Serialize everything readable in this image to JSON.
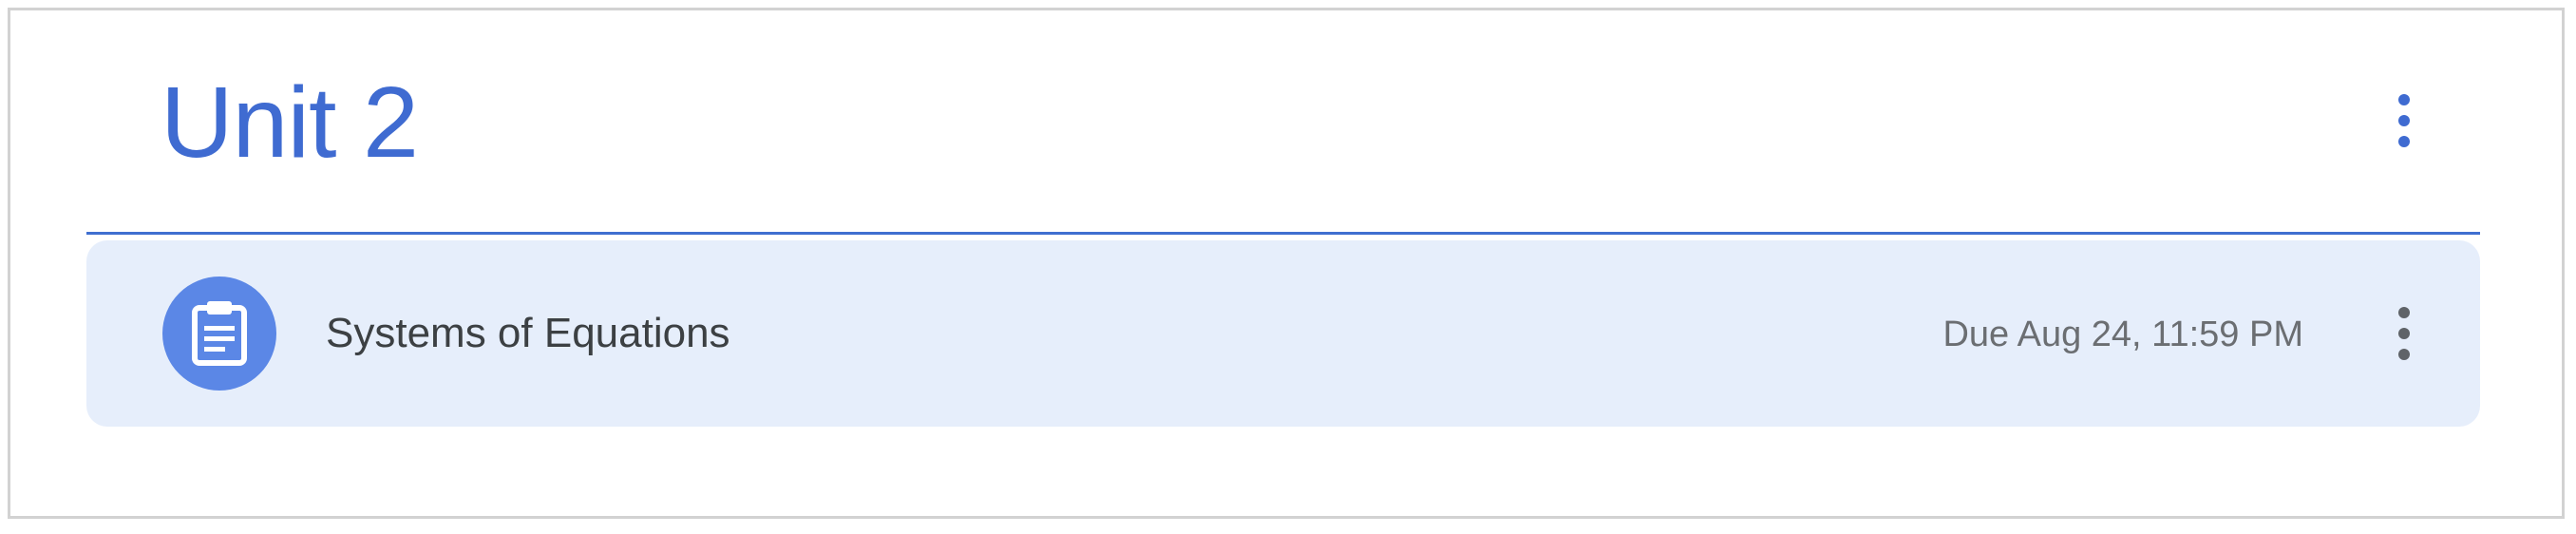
{
  "topic": {
    "title": "Unit 2",
    "more_icon": "more-vert-icon",
    "accent_color": "#3f6bd1"
  },
  "assignment": {
    "icon": "assignment-clipboard-icon",
    "title": "Systems of Equations",
    "due": "Due Aug 24, 11:59 PM",
    "more_icon": "more-vert-icon",
    "row_color": "#e6eefb",
    "icon_bg_color": "#5b87e6"
  }
}
